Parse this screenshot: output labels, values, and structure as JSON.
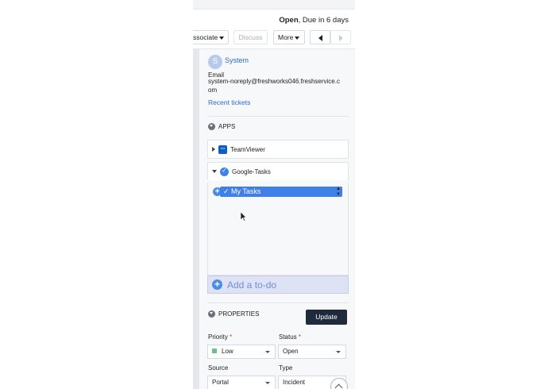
{
  "header": {
    "status_bold": "Open",
    "status_rest": ", Due in 6 days",
    "buttons": {
      "associate": "ssociate",
      "discuss": "Discuss",
      "more": "More"
    }
  },
  "requester": {
    "avatar_letter": "S",
    "name": "System",
    "email_label": "Email",
    "email_value": "system-noreply@freshworks046.freshservice.com",
    "recent_tickets": "Recent tickets"
  },
  "apps": {
    "title": "APPS",
    "items": [
      {
        "name": "TeamViewer",
        "expanded": false,
        "icon": "teamviewer-icon"
      },
      {
        "name": "Google-Tasks",
        "expanded": true,
        "icon": "google-tasks-icon"
      }
    ],
    "google_tasks": {
      "selected_list": "My Tasks",
      "add_todo": "Add a to-do"
    }
  },
  "properties": {
    "title": "PROPERTIES",
    "update_label": "Update",
    "priority": {
      "label": "Priority",
      "required": "*",
      "value": "Low",
      "color": "#6ac28b"
    },
    "status": {
      "label": "Status",
      "required": "*",
      "value": "Open"
    },
    "source": {
      "label": "Source",
      "value": "Portal"
    },
    "type": {
      "label": "Type",
      "value": "Incident"
    }
  },
  "colors": {
    "accent": "#2c6bd0",
    "update_button": "#1f2a3c",
    "todo_bg": "#dde2f5"
  }
}
